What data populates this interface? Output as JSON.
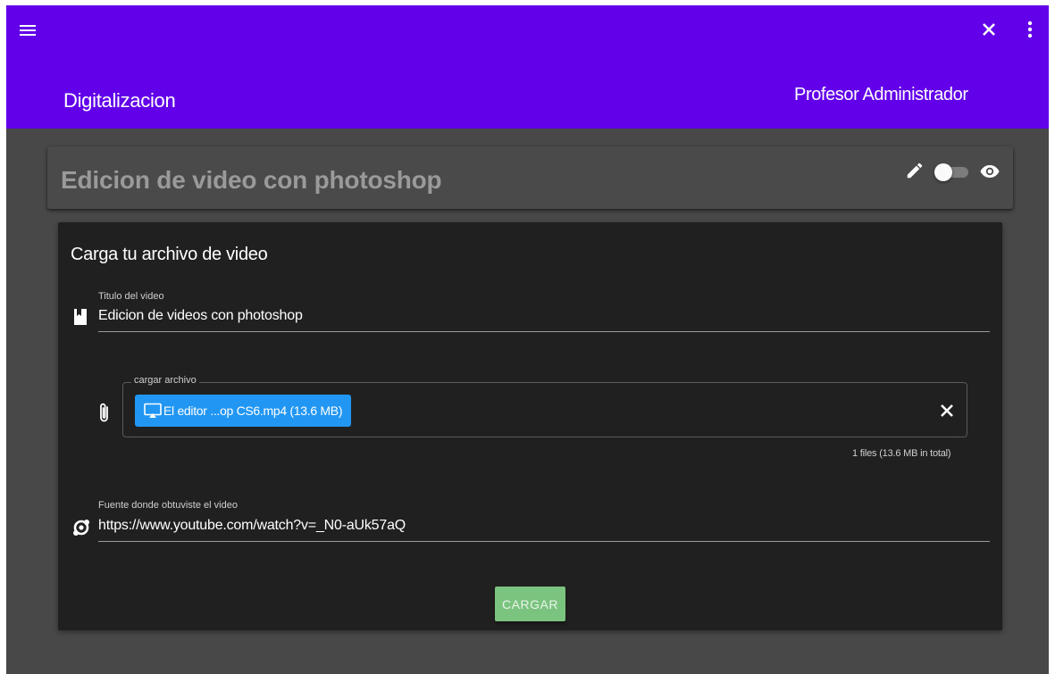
{
  "appbar": {
    "title": "Digitalizacion",
    "user_name": "Profesor Administrador",
    "color": "#6200ea",
    "icons": [
      "menu-icon",
      "close-icon",
      "more-vert-icon"
    ]
  },
  "course": {
    "title": "Edicion de video con photoshop",
    "icons": [
      "pencil-icon",
      "eye-icon"
    ],
    "toggle_on": false
  },
  "form": {
    "heading": "Carga tu archivo de video",
    "title_field": {
      "label": "Titulo del video",
      "value": "Edicion de videos con photoshop",
      "icon": "book-icon"
    },
    "file_field": {
      "legend": "cargar archivo",
      "icon": "paperclip-icon",
      "chip_label": "El editor ...op CS6.mp4 (13.6 MB)",
      "chip_icon": "video-file-icon",
      "summary": "1 files (13.6 MB in total)",
      "chip_color": "#2196f3"
    },
    "source_field": {
      "label": "Fuente donde obtuviste el video",
      "value": "https://www.youtube.com/watch?v=_N0-aUk57aQ",
      "icon": "source-link-icon"
    },
    "submit_label": "CARGAR",
    "submit_color": "#7bc47f"
  }
}
